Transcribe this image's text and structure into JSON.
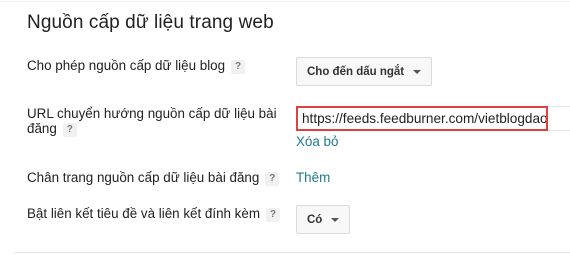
{
  "section": {
    "title": "Nguồn cấp dữ liệu trang web"
  },
  "rows": {
    "allow_feed": {
      "label": "Cho phép nguồn cấp dữ liệu blog",
      "help": "?",
      "value": "Cho đến dấu ngắt"
    },
    "redirect_url": {
      "label_line1": "URL chuyển hướng nguồn cấp dữ liệu bài",
      "label_line2": "đăng",
      "help": "?",
      "value": "https://feeds.feedburner.com/vietblogdao",
      "remove_label": "Xóa bỏ"
    },
    "post_footer": {
      "label": "Chân trang nguồn cấp dữ liệu bài đăng",
      "help": "?",
      "add_label": "Thêm"
    },
    "title_links": {
      "label": "Bật liên kết tiêu đề và liên kết đính kèm",
      "help": "?",
      "value": "Có"
    }
  },
  "colors": {
    "link": "#1f7a8c",
    "highlight_border": "#e0403f"
  }
}
